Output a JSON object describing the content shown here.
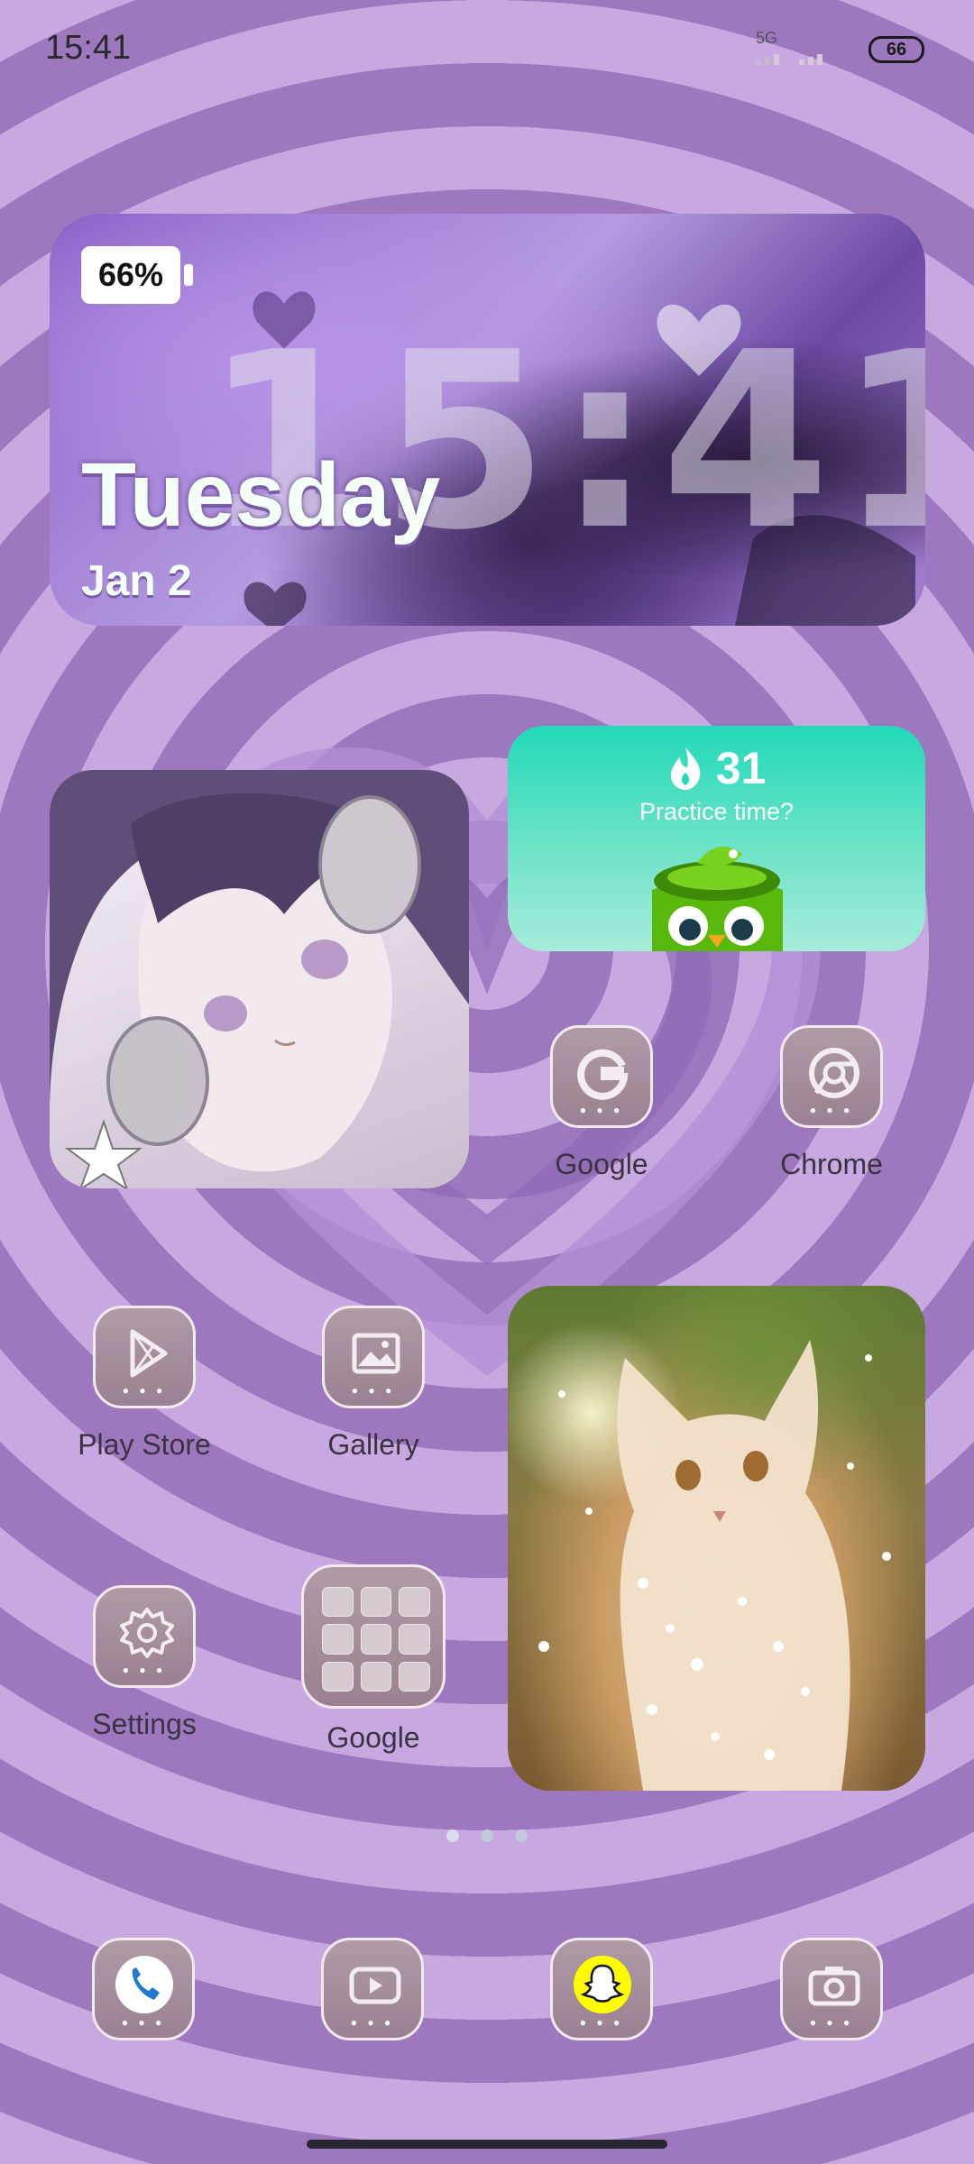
{
  "status_bar": {
    "time": "15:41",
    "network": "5G",
    "battery": "66"
  },
  "clock_widget": {
    "battery": "66%",
    "time": "15:41",
    "day": "Tuesday",
    "date": "Jan 2"
  },
  "duolingo_widget": {
    "streak": "31",
    "prompt": "Practice time?"
  },
  "apps": {
    "google": "Google",
    "chrome": "Chrome",
    "play_store": "Play Store",
    "gallery": "Gallery",
    "settings": "Settings",
    "google_folder": "Google"
  },
  "page_indicator": {
    "count": 3,
    "active": 1
  },
  "dock": [
    "phone-icon",
    "youtube-icon",
    "snapchat-icon",
    "camera-icon"
  ],
  "colors": {
    "bg_light": "#c8a8e0",
    "bg_dark": "#9d78bf",
    "icon_bg": "#a48c9b",
    "duo_green": "#21d9b9"
  }
}
